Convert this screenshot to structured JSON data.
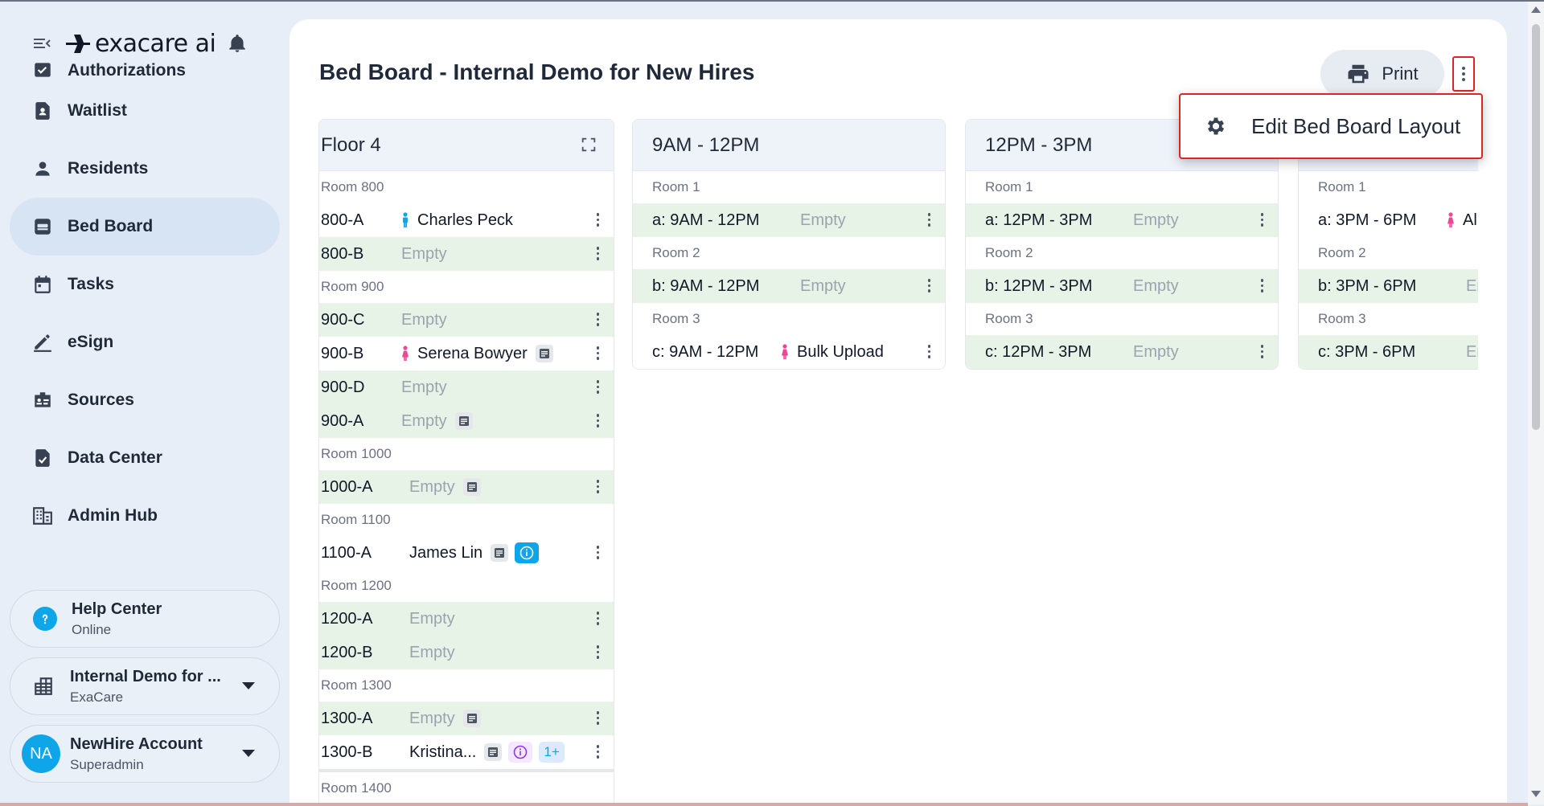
{
  "brand": {
    "name": "exacare ai"
  },
  "sidebar": {
    "items": [
      {
        "label": "Authorizations",
        "icon": "authorizations-icon"
      },
      {
        "label": "Waitlist",
        "icon": "waitlist-icon"
      },
      {
        "label": "Residents",
        "icon": "person-icon"
      },
      {
        "label": "Bed Board",
        "icon": "bed-icon"
      },
      {
        "label": "Tasks",
        "icon": "calendar-icon"
      },
      {
        "label": "eSign",
        "icon": "pen-icon"
      },
      {
        "label": "Sources",
        "icon": "sources-icon"
      },
      {
        "label": "Data Center",
        "icon": "data-center-icon"
      },
      {
        "label": "Admin Hub",
        "icon": "admin-hub-icon"
      }
    ],
    "active": "Bed Board",
    "help": {
      "title": "Help Center",
      "status": "Online"
    },
    "facility": {
      "name": "Internal Demo for ...",
      "org": "ExaCare"
    },
    "account": {
      "initials": "NA",
      "name": "NewHire Account",
      "role": "Superadmin"
    }
  },
  "header": {
    "title": "Bed Board - Internal Demo for New Hires",
    "print_label": "Print",
    "menu_item": "Edit Bed Board Layout"
  },
  "columns": [
    {
      "title": "Floor 4",
      "rooms": [
        {
          "label": "Room 800",
          "beds": [
            {
              "id": "800-A",
              "occupant": "Charles Peck",
              "gender": "male"
            },
            {
              "id": "800-B",
              "empty": "Empty"
            }
          ]
        },
        {
          "label": "Room 900",
          "beds": [
            {
              "id": "900-C",
              "empty": "Empty"
            },
            {
              "id": "900-B",
              "occupant": "Serena Bowyer",
              "gender": "female",
              "note": true
            },
            {
              "id": "900-D",
              "empty": "Empty"
            },
            {
              "id": "900-A",
              "empty": "Empty",
              "note": true
            }
          ]
        },
        {
          "label": "Room 1000",
          "beds": [
            {
              "id": "1000-A",
              "empty": "Empty",
              "note": true
            }
          ]
        },
        {
          "label": "Room 1100",
          "beds": [
            {
              "id": "1100-A",
              "occupant": "James Lin",
              "note": true,
              "info": "blue"
            }
          ]
        },
        {
          "label": "Room 1200",
          "beds": [
            {
              "id": "1200-A",
              "empty": "Empty"
            },
            {
              "id": "1200-B",
              "empty": "Empty"
            }
          ]
        },
        {
          "label": "Room 1300",
          "beds": [
            {
              "id": "1300-A",
              "empty": "Empty",
              "note": true
            },
            {
              "id": "1300-B",
              "occupant": "Kristina...",
              "note": true,
              "info": "purple",
              "badge": "1+"
            }
          ]
        },
        {
          "label": "Room 1400",
          "beds": []
        }
      ]
    },
    {
      "title": "9AM - 12PM",
      "rooms": [
        {
          "label": "Room 1",
          "beds": [
            {
              "id": "a: 9AM - 12PM",
              "empty": "Empty"
            }
          ]
        },
        {
          "label": "Room 2",
          "beds": [
            {
              "id": "b: 9AM - 12PM",
              "empty": "Empty"
            }
          ]
        },
        {
          "label": "Room 3",
          "beds": [
            {
              "id": "c: 9AM - 12PM",
              "occupant": "Bulk Upload",
              "gender": "female"
            }
          ]
        }
      ]
    },
    {
      "title": "12PM - 3PM",
      "rooms": [
        {
          "label": "Room 1",
          "beds": [
            {
              "id": "a: 12PM - 3PM",
              "empty": "Empty"
            }
          ]
        },
        {
          "label": "Room 2",
          "beds": [
            {
              "id": "b: 12PM - 3PM",
              "empty": "Empty"
            }
          ]
        },
        {
          "label": "Room 3",
          "beds": [
            {
              "id": "c: 12PM - 3PM",
              "empty": "Empty"
            }
          ]
        }
      ]
    },
    {
      "title": "",
      "rooms": [
        {
          "label": "Room 1",
          "beds": [
            {
              "id": "a: 3PM - 6PM",
              "occupant": "Ali",
              "gender": "female"
            }
          ]
        },
        {
          "label": "Room 2",
          "beds": [
            {
              "id": "b: 3PM - 6PM",
              "empty": "Em"
            }
          ]
        },
        {
          "label": "Room 3",
          "beds": [
            {
              "id": "c: 3PM - 6PM",
              "empty": "Em"
            }
          ]
        }
      ]
    }
  ],
  "colors": {
    "accent": "#d6e4f4",
    "occupied_row": "#e8f3e8",
    "male": "#0ea5e9",
    "female": "#ec4899",
    "highlight": "#dc2626"
  }
}
